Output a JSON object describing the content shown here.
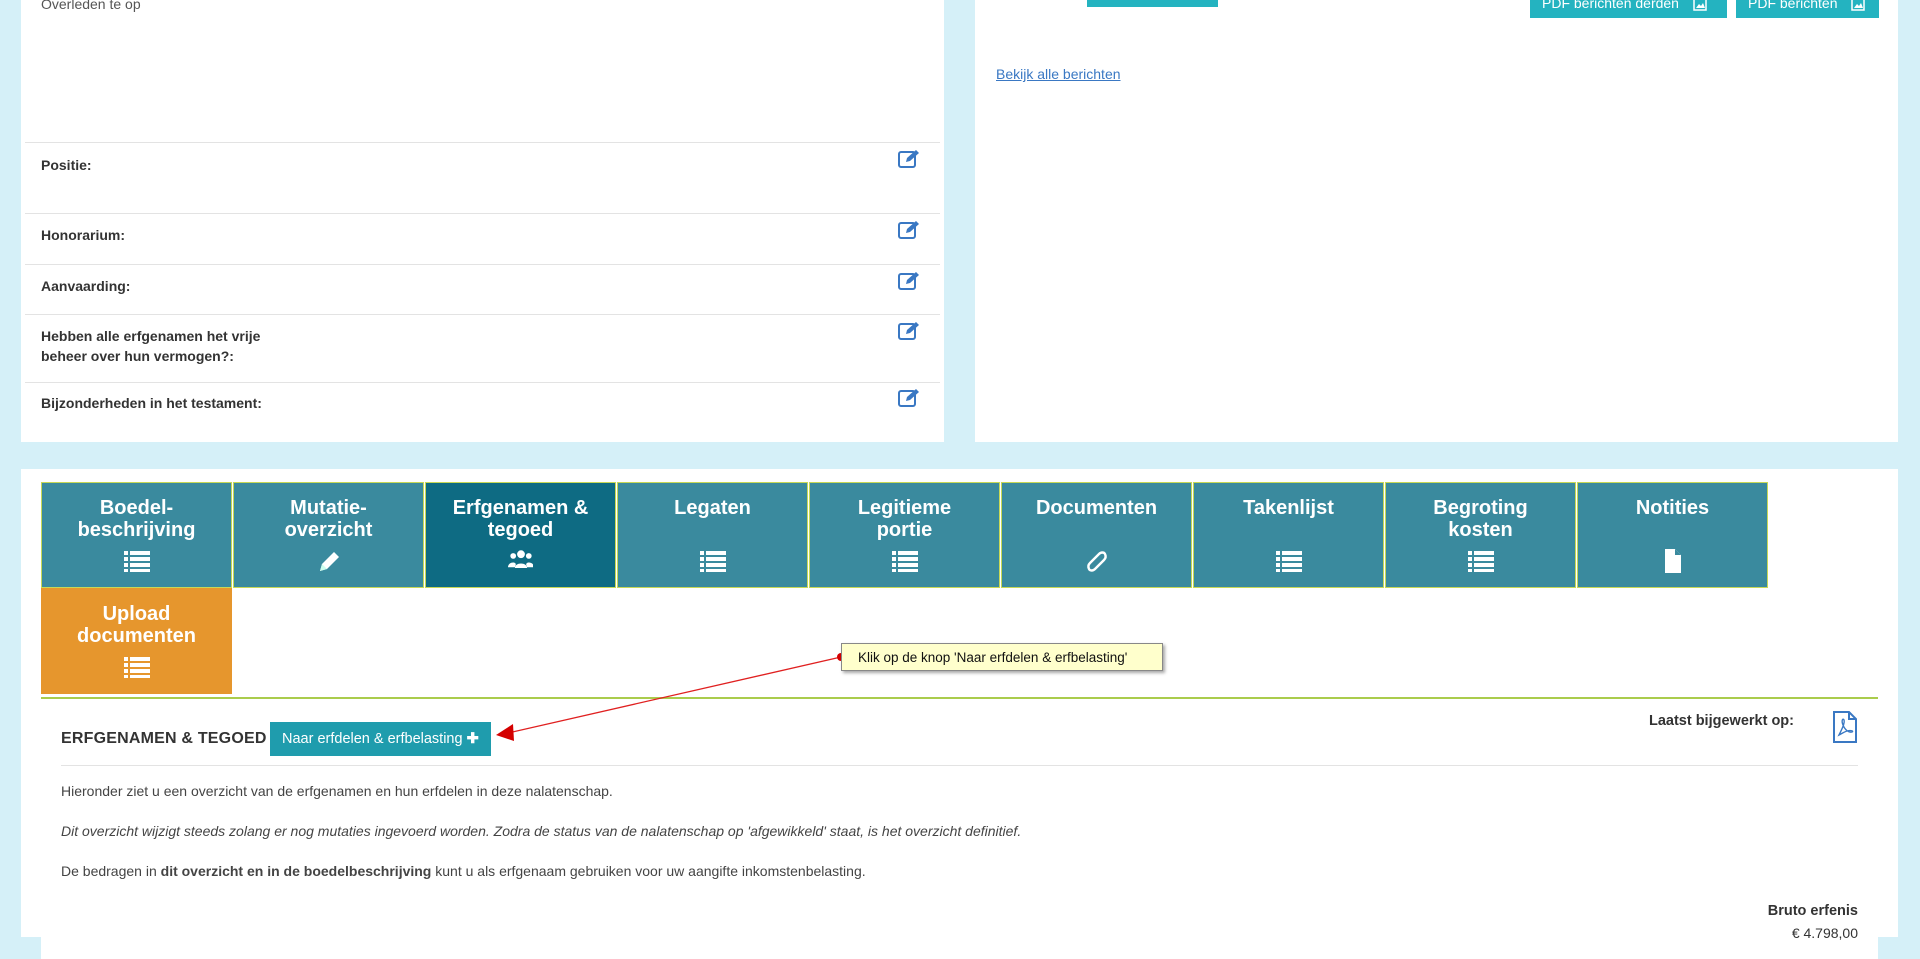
{
  "left_panel": {
    "overleden": "Overleden te op",
    "fields": [
      {
        "label": "Positie:"
      },
      {
        "label": "Honorarium:"
      },
      {
        "label": "Aanvaarding:"
      },
      {
        "label": "Hebben alle erfgenamen het vrije",
        "label2": "beheer over hun vermogen?:"
      },
      {
        "label": "Bijzonderheden in het testament:"
      }
    ]
  },
  "right_panel": {
    "btn_pdf_derden": "PDF berichten derden",
    "btn_pdf": "PDF berichten",
    "link_all": "Bekijk alle berichten"
  },
  "tabs": [
    {
      "label": "Boedel-\nbeschrijving",
      "icon": "list-icon"
    },
    {
      "label": "Mutatie-\noverzicht",
      "icon": "pencil-icon"
    },
    {
      "label": "Erfgenamen &\ntegoed",
      "icon": "users-icon",
      "active": true
    },
    {
      "label": "Legaten",
      "icon": "list-icon"
    },
    {
      "label": "Legitieme\nportie",
      "icon": "list-icon"
    },
    {
      "label": "Documenten",
      "icon": "paperclip-icon"
    },
    {
      "label": "Takenlijst",
      "icon": "list-icon"
    },
    {
      "label": "Begroting\nkosten",
      "icon": "list-icon"
    },
    {
      "label": "Notities",
      "icon": "file-icon"
    },
    {
      "label": "Upload\ndocumenten",
      "icon": "list-icon"
    }
  ],
  "content": {
    "title": "ERFGENAMEN & TEGOED",
    "btn_naar": "Naar erfdelen & erfbelasting",
    "laatst": "Laatst bijgewerkt op:",
    "p1": "Hieronder ziet u een overzicht van de erfgenamen en hun erfdelen in deze nalatenschap.",
    "p2": "Dit overzicht wijzigt steeds zolang er nog mutaties ingevoerd worden. Zodra de status van de nalatenschap op 'afgewikkeld' staat, is het overzicht definitief.",
    "p3_a": "De bedragen in ",
    "p3_b": "dit overzicht en in de boedelbeschrijving",
    "p3_c": " kunt u als erfgenaam gebruiken voor uw aangifte inkomstenbelasting.",
    "bruto_label": "Bruto erfenis",
    "bruto_value": "€ 4.798,00"
  },
  "callout": "Klik op de knop 'Naar erfdelen & erfbelasting'",
  "colors": {
    "tab": "#3a8a9e",
    "tab_active": "#0e6b83",
    "tab_upload": "#e6962d",
    "button": "#1f9cad",
    "callout_bg": "#ffffcc",
    "arrow": "#e02020"
  }
}
